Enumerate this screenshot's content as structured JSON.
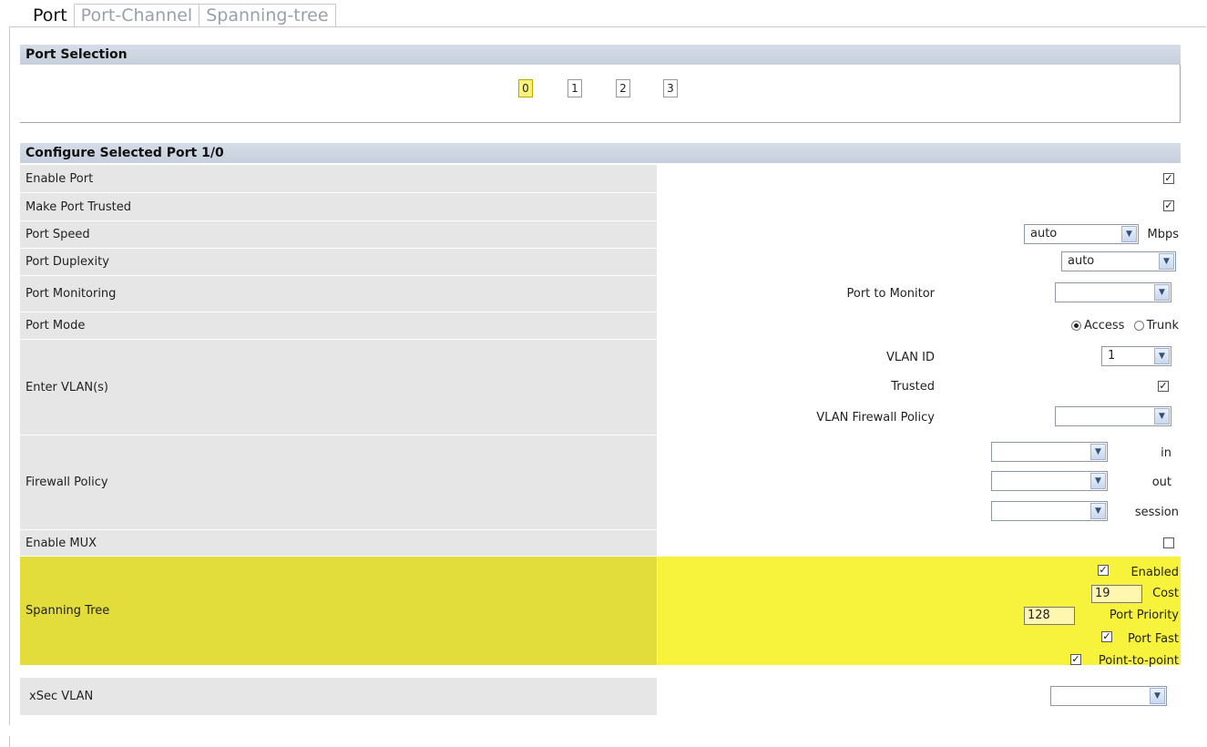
{
  "tabs": [
    "Port",
    "Port-Channel",
    "Spanning-tree"
  ],
  "port_selection": {
    "title": "Port Selection",
    "ports": [
      "0",
      "1",
      "2",
      "3"
    ],
    "selected": "0"
  },
  "configure": {
    "title": "Configure Selected Port 1/0",
    "enable_port": {
      "label": "Enable Port",
      "checked": true
    },
    "make_port_trusted": {
      "label": "Make Port Trusted",
      "checked": true
    },
    "port_speed": {
      "label": "Port Speed",
      "value": "auto",
      "unit": "Mbps"
    },
    "port_duplexity": {
      "label": "Port Duplexity",
      "value": "auto"
    },
    "port_monitoring": {
      "label": "Port Monitoring",
      "sub_label": "Port to Monitor",
      "value": ""
    },
    "port_mode": {
      "label": "Port Mode",
      "options": [
        "Access",
        "Trunk"
      ],
      "selected": "Access"
    },
    "enter_vlans": {
      "label": "Enter VLAN(s)",
      "vlan_id_label": "VLAN ID",
      "vlan_id_value": "1",
      "trusted_label": "Trusted",
      "trusted_checked": true,
      "vlan_firewall_label": "VLAN Firewall Policy",
      "vlan_firewall_value": ""
    },
    "firewall_policy": {
      "label": "Firewall Policy",
      "directions": [
        "in",
        "out",
        "session"
      ]
    },
    "enable_mux": {
      "label": "Enable MUX",
      "checked": false
    },
    "spanning_tree": {
      "label": "Spanning Tree",
      "enabled_label": "Enabled",
      "enabled": true,
      "cost_label": "Cost",
      "cost": "19",
      "priority_label": "Port Priority",
      "priority": "128",
      "port_fast_label": "Port Fast",
      "port_fast": true,
      "p2p_label": "Point-to-point",
      "p2p": true
    },
    "xsec_vlan": {
      "label": "xSec VLAN",
      "value": ""
    }
  },
  "colors": {
    "highlight": "#f7f33c",
    "selected_port": "#fff27a"
  },
  "icons": {
    "dropdown": "chevron-down-icon",
    "check": "checkmark-icon"
  }
}
